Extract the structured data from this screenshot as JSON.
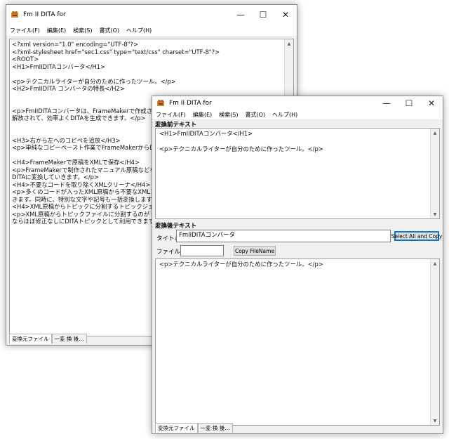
{
  "back_window": {
    "title": "Fm II DITA for",
    "menu": [
      "ファイル(F)",
      "編集(E)",
      "検索(S)",
      "書式(O)",
      "ヘルプ(H)"
    ],
    "editor_lines": [
      "<?xml version=\"1.0\" encoding=\"UTF-8\"?>",
      "<?xml-stylesheet href=\"sec1.css\" type=\"text/css\" charset=\"UTF-8\"?>",
      "<ROOT>",
      "<H1>FmIIDITAコンバータ</H1>",
      "",
      "<p>テクニカルライターが自分のために作ったツール。</p>",
      "<H2>FmIIDITA コンバータの特長</H2>",
      "",
      "",
      "<p>FmIIDITAコンバータは、FrameMakerで作成されたドキュメントをDITA化するためのツールです。単純なコピペ作業から",
      "解放されて、効率よくDITAを生成できます。</p>",
      "",
      "",
      "<H3>右から左へのコピペを追放</H3>",
      "<p>単純なコピーペースト作業でFrameMakerからDITA CMSへ",
      "",
      "<H4>FrameMakerで原稿をXMLで保存</H4>",
      "<p>FrameMakerで制作されたマニュアル原稿などをXMLで保存",
      "DITAに変換していきます。</p>",
      "<H4>不要なコードを取り除くXMLクリーナ</H4>",
      "<p>多くのコードが入ったXML原稿から不要なXMLコードを取り除",
      "きます。同時に、特別な文字や記号も一括変換します。</p>",
      "<H4>XML原稿からトピックに分割するトピックジェネレータ</H4>",
      "<p>XML原稿からトピックファイルに分割するのがトピックジェネレー",
      "ならほぼ修正なしにDITAトピックとして利用できます。また、テーブ"
    ],
    "tabs": [
      "変換元ファイル",
      "一変 換 後…"
    ]
  },
  "front_window": {
    "title": "Fm II DITA for",
    "menu": [
      "ファイル(F)",
      "編集(E)",
      "検索(S)",
      "書式(O)",
      "ヘルプ(H)"
    ],
    "before_label": "変換前テキスト",
    "before_text": "<H1>FmIIDITAコンバータ</H1>\n\n<p>テクニカルライターが自分のために作ったツール。</p>",
    "after_label": "変換後テキスト",
    "title_label": "タイトル",
    "title_value": "FmIIDITAコンバータ",
    "select_all_copy": "Select All and Copy",
    "filename_label": "ファイル名",
    "filename_value": "",
    "copy_filename": "Copy FileName",
    "after_text": "<p>テクニカルライターが自分のために作ったツール。</p>",
    "tabs": [
      "変換元ファイル",
      "一変 換 後…"
    ]
  },
  "controls": {
    "minimize": "—",
    "maximize": "☐",
    "close": "✕"
  },
  "colors": {
    "accent": "#0078d7",
    "title_bg": "#ffffff",
    "window_bg": "#f0f0f0"
  }
}
